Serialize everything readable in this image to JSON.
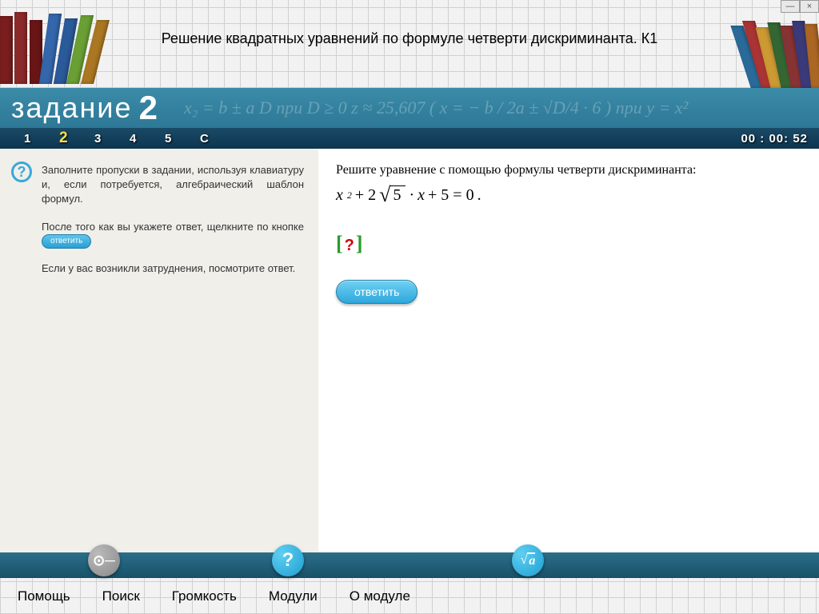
{
  "window": {
    "minimize": "—",
    "close": "×"
  },
  "header": {
    "title": "Решение квадратных уравнений по формуле четверти дискриминанта. К1"
  },
  "banner": {
    "label": "задание",
    "number": "2",
    "formula_bg": "x₂ = b ± a   D   при D ≥ 0    z ≈ 25,607  ( x = − b / 2a ± √D/4 · 6 )   при   y = x²"
  },
  "nav": {
    "items": [
      "1",
      "2",
      "3",
      "4",
      "5",
      "С"
    ],
    "active_index": 1,
    "timer": "00 : 00: 52"
  },
  "instructions": {
    "p1": "Заполните пропуски в задании, используя клавиатуру и, если потребуется, алгебраический шаблон формул.",
    "p2_before": "После того как вы укажете ответ, щелкните по кнопке ",
    "p2_pill": "ответить",
    "p3": "Если у вас возникли затруднения,  посмотрите ответ."
  },
  "problem": {
    "text": "Решите уравнение с помощью формулы четверти дискриминанта:",
    "equation_parts": {
      "x": "x",
      "sq": "2",
      "plus1": " +  2",
      "root": "5",
      "dot_x": " · ",
      "x2": "x",
      "plus2": " +  5  =  0",
      "period": " ."
    },
    "placeholder": "?",
    "answer_button": "ответить"
  },
  "toolstrip": {
    "key_icon": "⚿",
    "help_icon": "?",
    "formula_icon_radical": "√",
    "formula_icon_var": "a"
  },
  "footer": {
    "items": [
      "Помощь",
      "Поиск",
      "Громкость",
      "Модули",
      "О модуле"
    ]
  }
}
